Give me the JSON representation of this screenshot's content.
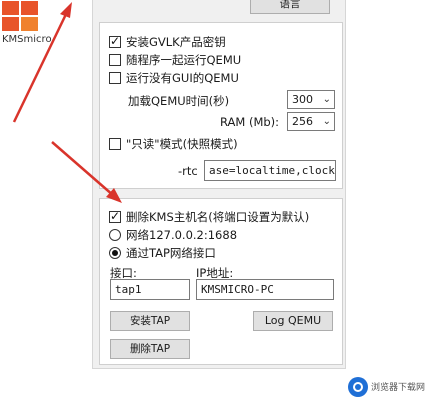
{
  "desktop": {
    "icon_label": "KMSmicro"
  },
  "dialog": {
    "language_button": "语言",
    "options": {
      "install_gvlk": {
        "label": "安装GVLK产品密钥",
        "checked": true
      },
      "run_with_program": {
        "label": "随程序一起运行QEMU",
        "checked": false
      },
      "run_without_gui": {
        "label": "运行没有GUI的QEMU",
        "checked": false
      }
    },
    "load_time": {
      "label": "加载QEMU时间(秒)",
      "value": "300"
    },
    "ram": {
      "label": "RAM (Mb):",
      "value": "256"
    },
    "readonly_mode": {
      "label": "\"只读\"模式(快照模式)",
      "checked": false
    },
    "rtc_prefix": "-rtc",
    "rtc_value": "ase=localtime,clock=h",
    "delete_kms": {
      "label": "删除KMS主机名(将端口设置为默认)",
      "checked": true
    },
    "network_radio": {
      "label": "网络127.0.0.2:1688",
      "checked": false
    },
    "tap_radio": {
      "label": "通过TAP网络接口",
      "checked": true
    },
    "interface_label": "接口:",
    "interface_value": "tap1",
    "ip_label": "IP地址:",
    "ip_value": "KMSMICRO-PC",
    "install_tap_button": "安装TAP",
    "log_qemu_button": "Log QEMU",
    "remove_tap_button": "删除TAP"
  },
  "watermark": {
    "text": "浏览器下载网"
  },
  "colors": {
    "arrow": "#d9342b",
    "panel": "#f0f0f0",
    "group": "#ffffff"
  }
}
